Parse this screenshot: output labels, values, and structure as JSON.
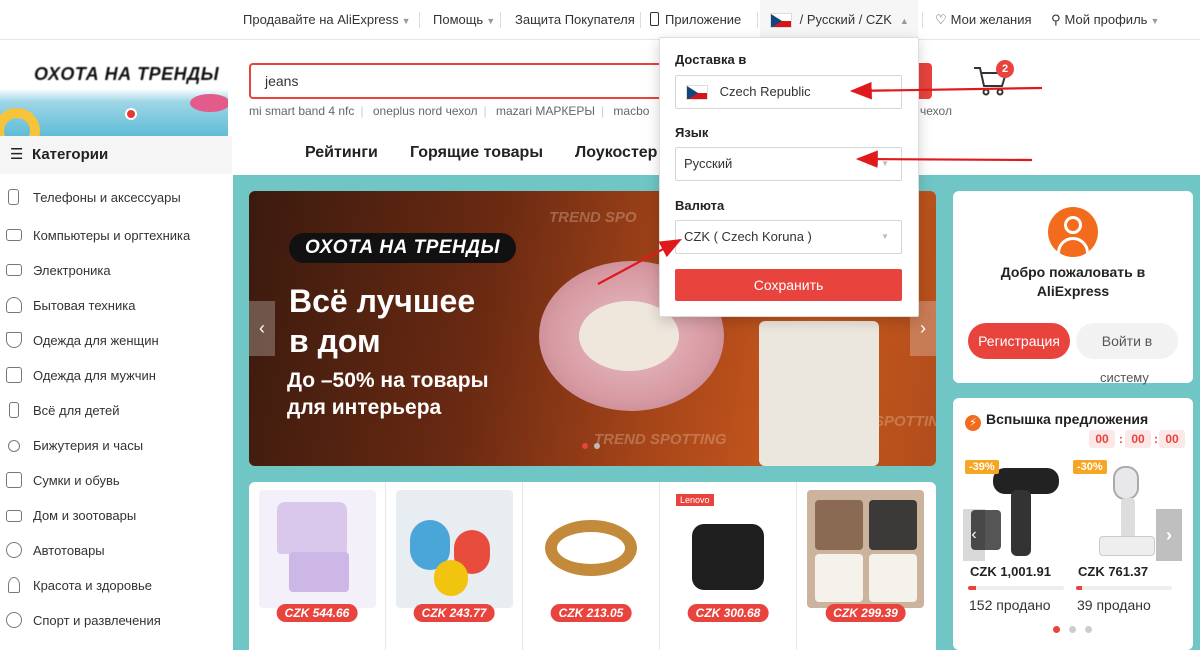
{
  "topbar": {
    "sell": "Продавайте на AliExpress",
    "help": "Помощь",
    "protection": "Защита Покупателя",
    "app": "Приложение",
    "locale": "/ Русский /  CZK",
    "wishlist": "Мои желания",
    "profile": "Мой профиль"
  },
  "logo_banner": {
    "title": "ОХОТА НА ТРЕНДЫ"
  },
  "search": {
    "value": "jeans",
    "hotwords": [
      "mi smart band 4 nfc",
      "oneplus nord чехол",
      "mazari МАРКЕРЫ",
      "macbo"
    ],
    "hotword_tail": "чехол"
  },
  "cart": {
    "count": "2"
  },
  "categories": {
    "title": "Категории",
    "items": [
      "Телефоны и аксессуары",
      "Компьютеры и оргтехника",
      "Электроника",
      "Бытовая техника",
      "Одежда для женщин",
      "Одежда для мужчин",
      "Всё для детей",
      "Бижутерия и часы",
      "Сумки и обувь",
      "Дом и зоотовары",
      "Автотовары",
      "Красота и здоровье",
      "Спорт и развлечения"
    ]
  },
  "nav": {
    "ratings": "Рейтинги",
    "hot": "Горящие товары",
    "lowcost": "Лоукостер"
  },
  "hero": {
    "pill": "ОХОТА НА ТРЕНДЫ",
    "line1": "Всё лучшее",
    "line2": "в дом",
    "line3": "До –50% на товары",
    "line4": "для интерьера",
    "watermark1": "TREND SPO",
    "watermark2": "TREND SPOTTING",
    "watermark3": "SPOTTIN"
  },
  "products": [
    {
      "price": "CZK 544.66",
      "color": "#d9c8ec"
    },
    {
      "price": "CZK 243.77",
      "color": "#4aa6d8"
    },
    {
      "price": "CZK 213.05",
      "color": "#c28a3a"
    },
    {
      "price": "CZK 300.68",
      "color": "#1e1e1e",
      "brand": "Lenovo"
    },
    {
      "price": "CZK 299.39",
      "color": "#b58b6c"
    }
  ],
  "welcome": {
    "line1": "Добро пожаловать в",
    "line2": "AliExpress",
    "register": "Регистрация",
    "login": "Войти в",
    "login_tail": "систему"
  },
  "flash": {
    "title": "Вспышка предложения",
    "timer": [
      "00",
      "00",
      "00"
    ],
    "deals": [
      {
        "badge": "-39%",
        "price": "CZK 1,001.91",
        "sold": "152 продано",
        "progress": 0.08
      },
      {
        "badge": "-30%",
        "price": "CZK 761.37",
        "sold": "39 продано",
        "progress": 0.06
      }
    ]
  },
  "dropdown": {
    "ship_label": "Доставка в",
    "ship_value": "Czech Republic",
    "lang_label": "Язык",
    "lang_value": "Русский",
    "currency_label": "Валюта",
    "currency_value": "CZK ( Czech Koruna )",
    "save": "Сохранить"
  },
  "colors": {
    "accent": "#e8433d",
    "teal": "#6fc6c5",
    "annotation": "#e0191d"
  }
}
